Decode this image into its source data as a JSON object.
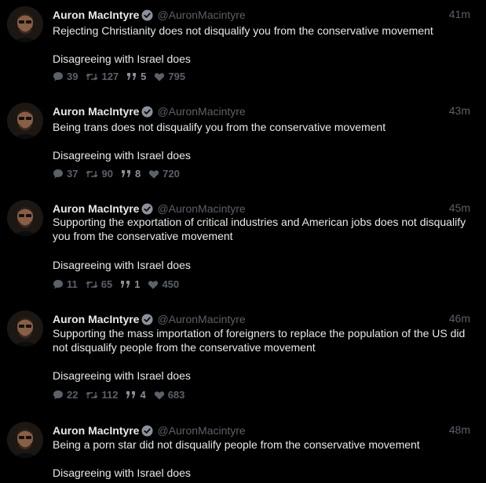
{
  "tweets": [
    {
      "name": "Auron MacIntyre",
      "handle": "@AuronMacintyre",
      "time": "41m",
      "line1": "Rejecting Christianity does not disqualify you from the conservative movement",
      "line2": "Disagreeing with Israel does",
      "replies": "39",
      "retweets": "127",
      "quotes": "5",
      "likes": "795"
    },
    {
      "name": "Auron MacIntyre",
      "handle": "@AuronMacintyre",
      "time": "43m",
      "line1": "Being trans does not disqualify you from the conservative movement",
      "line2": "Disagreeing with Israel does",
      "replies": "37",
      "retweets": "90",
      "quotes": "8",
      "likes": "720"
    },
    {
      "name": "Auron MacIntyre",
      "handle": "@AuronMacintyre",
      "time": "45m",
      "line1": "Supporting the exportation of critical industries and American jobs does not disqualify you from the conservative movement",
      "line2": "Disagreeing with Israel does",
      "replies": "11",
      "retweets": "65",
      "quotes": "1",
      "likes": "450"
    },
    {
      "name": "Auron MacIntyre",
      "handle": "@AuronMacintyre",
      "time": "46m",
      "line1": "Supporting the mass importation of foreigners to replace the population of the US did not disqualify people from the conservative movement",
      "line2": "Disagreeing with Israel does",
      "replies": "22",
      "retweets": "112",
      "quotes": "4",
      "likes": "683"
    },
    {
      "name": "Auron MacIntyre",
      "handle": "@AuronMacintyre",
      "time": "48m",
      "line1": "Being a porn star did not disqualify people from the conservative movement",
      "line2": "Disagreeing with Israel does"
    }
  ],
  "icons": {
    "reply": "speech-bubble-icon",
    "retweet": "retweet-arrows-icon",
    "quote": "quote-marks-icon",
    "like": "heart-icon",
    "verified": "verified-badge-icon"
  },
  "colors": {
    "background": "#000000",
    "text": "#e7e9ea",
    "muted": "#5b6169",
    "verified": "#8a9099"
  }
}
